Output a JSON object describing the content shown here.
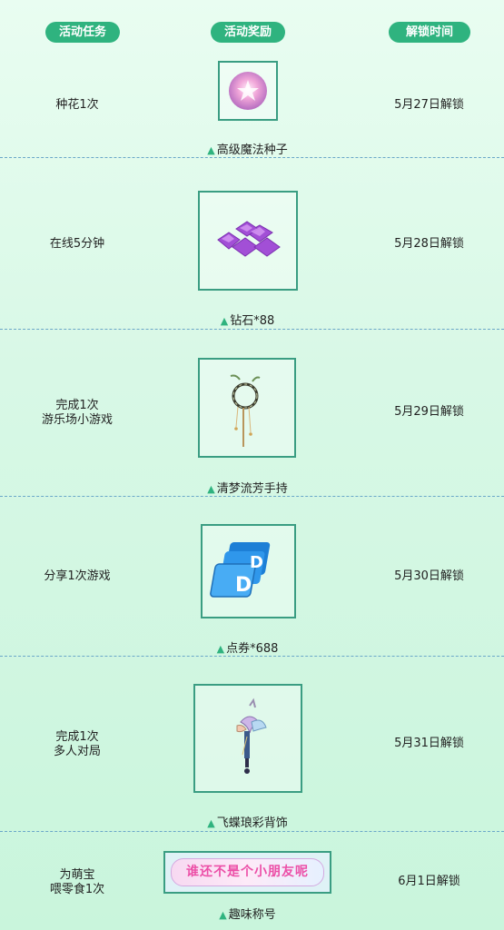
{
  "header": {
    "col_task": "活动任务",
    "col_reward": "活动奖励",
    "col_unlock": "解锁时间"
  },
  "rows": [
    {
      "task_lines": [
        "种花1次"
      ],
      "reward": "高级魔法种子",
      "unlock": "5月27日解锁",
      "icon": "magic-seed-icon"
    },
    {
      "task_lines": [
        "在线5分钟"
      ],
      "reward": "钻石*88",
      "unlock": "5月28日解锁",
      "icon": "diamond-icon"
    },
    {
      "task_lines": [
        "完成1次",
        "游乐场小游戏"
      ],
      "reward": "清梦流芳手持",
      "unlock": "5月29日解锁",
      "icon": "handheld-wreath-icon"
    },
    {
      "task_lines": [
        "分享1次游戏"
      ],
      "reward": "点券*688",
      "unlock": "5月30日解锁",
      "icon": "coupon-icon"
    },
    {
      "task_lines": [
        "完成1次",
        "多人对局"
      ],
      "reward": "飞蝶琅彩背饰",
      "unlock": "5月31日解锁",
      "icon": "butterfly-back-accessory-icon"
    },
    {
      "task_lines": [
        "为萌宝",
        "喂零食1次"
      ],
      "reward": "趣味称号",
      "unlock": "6月1日解锁",
      "icon": "title-badge-icon",
      "title_badge_text": "谁还不是个小朋友呢"
    }
  ],
  "triangle": "▲",
  "colors": {
    "accent": "#2fb37f",
    "box_border": "#3a9d82",
    "divider": "#6aa7c8"
  }
}
